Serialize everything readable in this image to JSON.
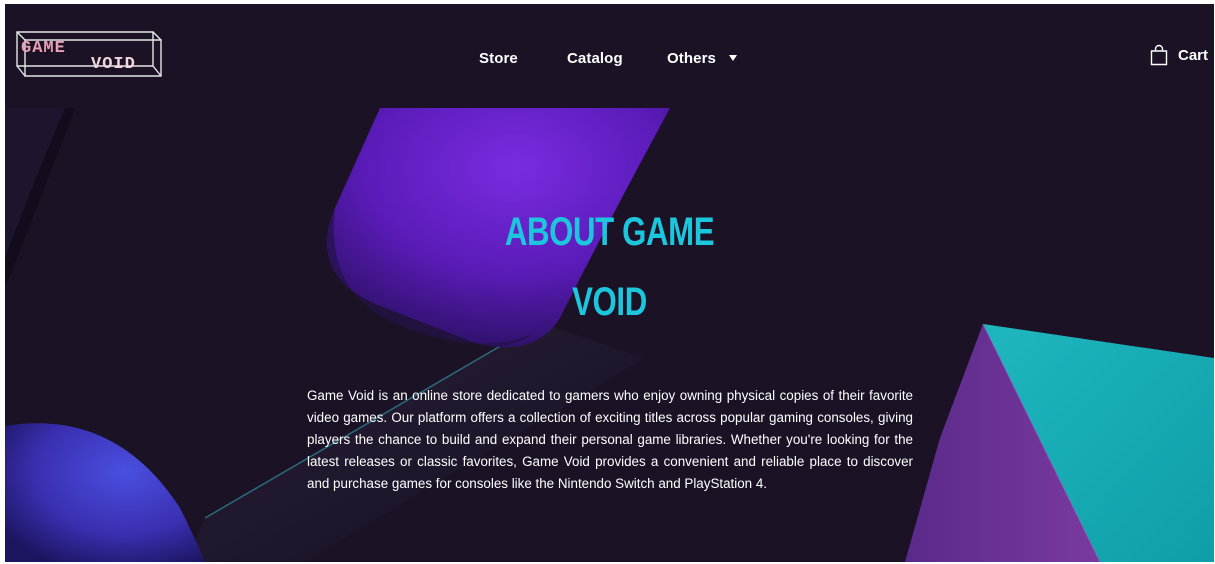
{
  "brand": {
    "logo_text": "GAME VOID",
    "logo_word_1": "GAME",
    "logo_word_2": "VOID"
  },
  "nav": {
    "items": [
      {
        "label": "Store"
      },
      {
        "label": "Catalog"
      },
      {
        "label": "Others"
      }
    ],
    "cart_label": "Cart"
  },
  "hero": {
    "title_line_1": "ABOUT GAME",
    "title_line_2": "VOID",
    "description": "Game Void is an online store dedicated to gamers who enjoy owning physical copies of their favorite video games. Our platform offers a collection of exciting titles across popular gaming consoles, giving players the chance to build and expand their personal game libraries. Whether you're looking for the latest releases or classic favorites, Game Void provides a convenient and reliable place to discover and purchase games for consoles like the Nintendo Switch and PlayStation 4."
  },
  "colors": {
    "background": "#1b1226",
    "accent": "#1cc6dd",
    "text": "#ffffff",
    "logo_pink": "#e8a0b4"
  },
  "icons": [
    "shopping-bag-icon",
    "caret-down-icon",
    "game-void-logo"
  ]
}
